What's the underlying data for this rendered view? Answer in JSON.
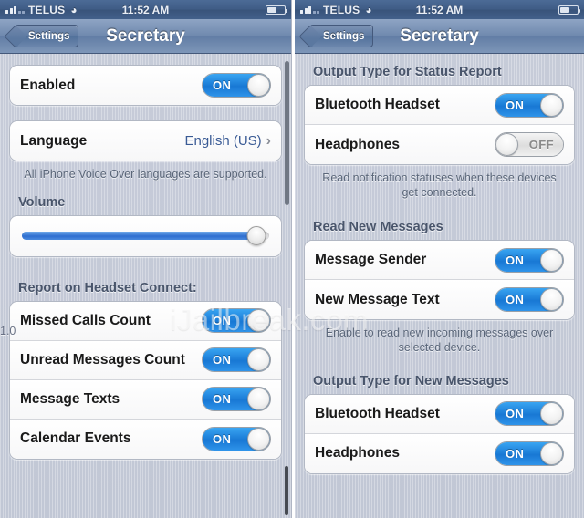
{
  "status_bar": {
    "carrier": "TELUS",
    "wifi_icon": "wifi-icon",
    "time": "11:52 AM",
    "battery_icon": "battery-icon"
  },
  "nav": {
    "back_label": "Settings",
    "title": "Secretary"
  },
  "watermark": {
    "text": "iJailbreak.com"
  },
  "colors": {
    "toggle_on": "#1878d4",
    "toggle_off": "#dddddd",
    "slider_fill": "#2f6fd0",
    "nav_bar": "#6f89ae",
    "value_text": "#3a5b95"
  },
  "left_screen": {
    "groups": [
      {
        "header": "",
        "rows": [
          {
            "label": "Enabled",
            "control": "toggle",
            "state": "ON"
          }
        ],
        "footer": ""
      },
      {
        "header": "",
        "rows": [
          {
            "label": "Language",
            "control": "disclosure",
            "value": "English (US)",
            "chevron": "›"
          }
        ],
        "footer": "All iPhone Voice Over languages are supported."
      },
      {
        "header": "Volume",
        "rows": [
          {
            "label": "",
            "control": "slider",
            "value": "1.0",
            "percent": 95
          }
        ],
        "footer": ""
      },
      {
        "header": "Report on Headset Connect:",
        "rows": [
          {
            "label": "Missed Calls Count",
            "control": "toggle",
            "state": "ON"
          },
          {
            "label": "Unread Messages Count",
            "control": "toggle",
            "state": "ON"
          },
          {
            "label": "Message Texts",
            "control": "toggle",
            "state": "ON"
          },
          {
            "label": "Calendar Events",
            "control": "toggle",
            "state": "ON"
          }
        ],
        "footer": ""
      }
    ]
  },
  "right_screen": {
    "groups": [
      {
        "header": "Output Type for Status Report",
        "rows": [
          {
            "label": "Bluetooth Headset",
            "control": "toggle",
            "state": "ON"
          },
          {
            "label": "Headphones",
            "control": "toggle",
            "state": "OFF"
          }
        ],
        "footer": "Read notification statuses when these devices get connected."
      },
      {
        "header": "Read New Messages",
        "rows": [
          {
            "label": "Message Sender",
            "control": "toggle",
            "state": "ON"
          },
          {
            "label": "New Message Text",
            "control": "toggle",
            "state": "ON"
          }
        ],
        "footer": "Enable to read new incoming messages over selected device."
      },
      {
        "header": "Output Type for New Messages",
        "rows": [
          {
            "label": "Bluetooth Headset",
            "control": "toggle",
            "state": "ON"
          },
          {
            "label": "Headphones",
            "control": "toggle",
            "state": "ON"
          }
        ],
        "footer": ""
      }
    ]
  }
}
